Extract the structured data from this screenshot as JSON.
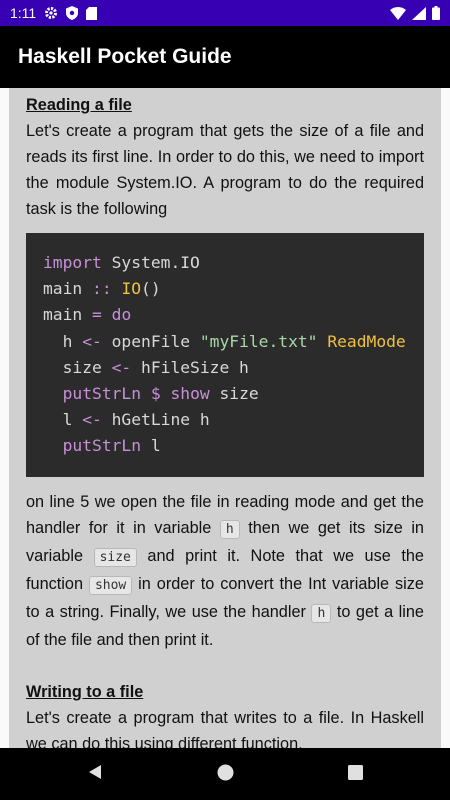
{
  "status_bar": {
    "time": "1:11",
    "icons": [
      "gear-icon",
      "shield-icon",
      "sd-card-icon",
      "wifi-icon",
      "cellular-icon",
      "battery-icon"
    ]
  },
  "app_bar": {
    "title": "Haskell Pocket Guide"
  },
  "section1": {
    "heading": "Reading a file",
    "intro": "Let's create a program that gets the size of a file and reads its first line. In order to do this, we need to import the module System.IO. A program to do the required task is the following",
    "code_lines": [
      [
        {
          "c": "kw",
          "t": "import"
        },
        {
          "c": "pl",
          "t": " System.IO"
        }
      ],
      [
        {
          "c": "pl",
          "t": "main "
        },
        {
          "c": "kw",
          "t": "::"
        },
        {
          "c": "pl",
          "t": " "
        },
        {
          "c": "ty",
          "t": "IO"
        },
        {
          "c": "pl",
          "t": "()"
        }
      ],
      [
        {
          "c": "pl",
          "t": "main "
        },
        {
          "c": "kw",
          "t": "="
        },
        {
          "c": "pl",
          "t": " "
        },
        {
          "c": "kw",
          "t": "do"
        }
      ],
      [
        {
          "c": "pl",
          "t": "  h "
        },
        {
          "c": "kw",
          "t": "<-"
        },
        {
          "c": "pl",
          "t": " openFile "
        },
        {
          "c": "str",
          "t": "\"myFile.txt\""
        },
        {
          "c": "pl",
          "t": " "
        },
        {
          "c": "ty",
          "t": "ReadMode"
        }
      ],
      [
        {
          "c": "pl",
          "t": "  size "
        },
        {
          "c": "kw",
          "t": "<-"
        },
        {
          "c": "pl",
          "t": " hFileSize h"
        }
      ],
      [
        {
          "c": "pl",
          "t": "  "
        },
        {
          "c": "kw",
          "t": "putStrLn"
        },
        {
          "c": "pl",
          "t": " "
        },
        {
          "c": "kw",
          "t": "$"
        },
        {
          "c": "pl",
          "t": " "
        },
        {
          "c": "kw",
          "t": "show"
        },
        {
          "c": "pl",
          "t": " size"
        }
      ],
      [
        {
          "c": "pl",
          "t": "  l "
        },
        {
          "c": "kw",
          "t": "<-"
        },
        {
          "c": "pl",
          "t": " hGetLine h"
        }
      ],
      [
        {
          "c": "pl",
          "t": "  "
        },
        {
          "c": "kw",
          "t": "putStrLn"
        },
        {
          "c": "pl",
          "t": " l"
        }
      ]
    ],
    "explain_1": "on line 5 we open the file in reading mode and get the handler for it in variable ",
    "code_h": "h",
    "explain_2": " then we get its size in variable ",
    "code_size": "size",
    "explain_3": " and print it. Note that we use the function ",
    "code_show": "show",
    "explain_4": " in order to convert the Int variable size to a string. Finally, we use the handler ",
    "code_h2": "h",
    "explain_5": " to get a line of the file and then print it."
  },
  "section2": {
    "heading": "Writing to a file",
    "intro": "Let's create a program that writes to a file. In Haskell we can do this using different function,"
  },
  "nav_bar": {
    "icons": [
      "back-icon",
      "home-icon",
      "recents-icon"
    ]
  }
}
